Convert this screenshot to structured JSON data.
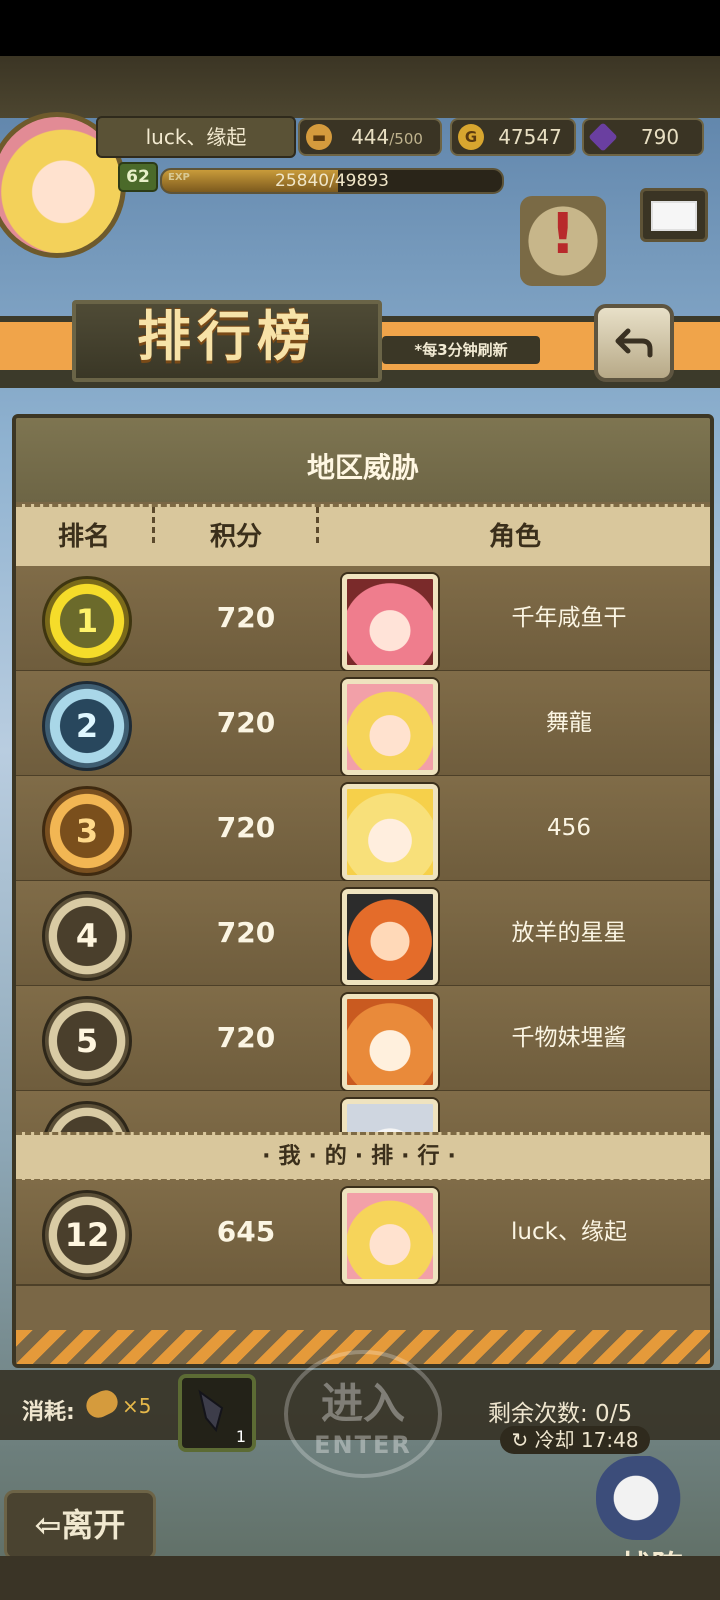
{
  "hud": {
    "player_name": "luck、缘起",
    "level": "62",
    "exp_tag": "EXP",
    "exp_text": "25840/49893",
    "exp_fraction": 0.518,
    "stamina": "444",
    "stamina_max": "/500",
    "gold": "47547",
    "gold_icon": "G",
    "gems": "790"
  },
  "banner": {
    "title": "排行榜",
    "note": "*每3分钟刷新"
  },
  "panel": {
    "title": "地区威胁",
    "columns": [
      "排名",
      "积分",
      "角色"
    ],
    "rows": [
      {
        "rank": "1",
        "score": "720",
        "name": "千年咸鱼干"
      },
      {
        "rank": "2",
        "score": "720",
        "name": "舞龍"
      },
      {
        "rank": "3",
        "score": "720",
        "name": "456"
      },
      {
        "rank": "4",
        "score": "720",
        "name": "放羊的星星"
      },
      {
        "rank": "5",
        "score": "720",
        "name": "千物妹埋酱"
      }
    ],
    "my_rank_label": "·我·的·排·行·",
    "my_row": {
      "rank": "12",
      "score": "645",
      "name": "luck、缘起"
    }
  },
  "bottom": {
    "cost_label": "消耗:",
    "cost_count": "×5",
    "item_count": "1",
    "enter_cn": "进入",
    "enter_en": "ENTER",
    "remaining": "剩余次数: 0/5",
    "cooldown": "冷却 17:48",
    "leave": "离开",
    "formation": "战阵"
  }
}
